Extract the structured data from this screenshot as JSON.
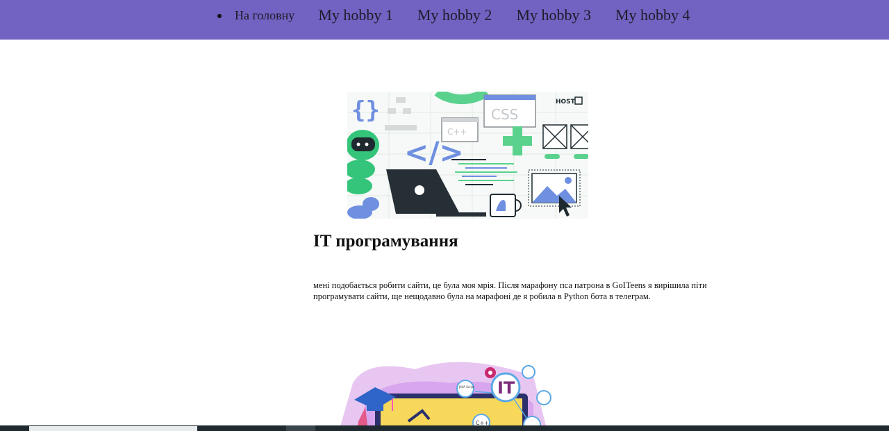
{
  "nav": {
    "home_label": "На головну",
    "hobbies": [
      "My hobby 1",
      "My hobby 2",
      "My hobby 3",
      "My hobby 4"
    ]
  },
  "hero1": {
    "css_label": "CSS",
    "cpp_label": "C++",
    "brand": "HOST"
  },
  "main": {
    "title": "IT програмування",
    "paragraph": "мені подобається робити сайти, це була моя мрія. Після марафону пса патрона в GoITeens я вирішила піти програмувати сайти, ще нещодавно була на марафоні де я робила в Python бота в телеграм."
  },
  "hero2": {
    "it_label": "IT",
    "cpp_label": "C++",
    "java_label": "JAVA Script"
  },
  "colors": {
    "nav_bg": "#7262c1",
    "accent_green": "#5ad28e",
    "accent_blue": "#6f8fe0"
  }
}
